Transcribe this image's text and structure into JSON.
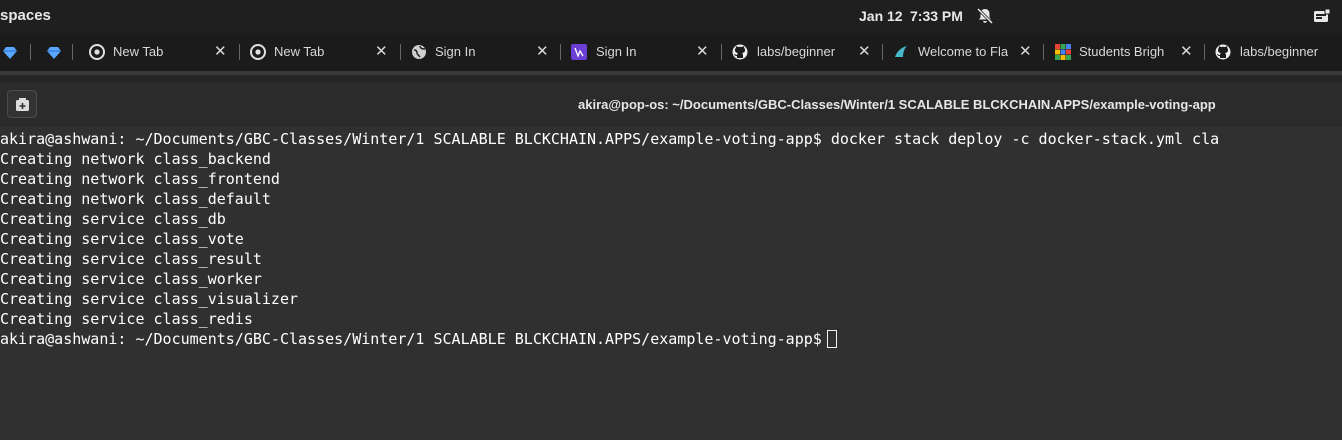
{
  "top_bar": {
    "workspace": "spaces",
    "date": "Jan 12",
    "time": "7:33 PM",
    "icons": [
      "notifications-off-icon",
      "system-menu-icon"
    ]
  },
  "browser_tabs": [
    {
      "label": "",
      "icon": "diamond-icon",
      "closable": false
    },
    {
      "label": "",
      "icon": "diamond-icon",
      "closable": false
    },
    {
      "label": "New Tab",
      "icon": "chrome-icon",
      "closable": true
    },
    {
      "label": "New Tab",
      "icon": "chrome-icon",
      "closable": true
    },
    {
      "label": "Sign In",
      "icon": "globe-icon",
      "closable": true
    },
    {
      "label": "Sign In",
      "icon": "purple-app-icon",
      "closable": true
    },
    {
      "label": "labs/beginner",
      "icon": "github-icon",
      "closable": true
    },
    {
      "label": "Welcome to Fla",
      "icon": "flask-icon",
      "closable": true
    },
    {
      "label": "Students Brigh",
      "icon": "grid-icon",
      "closable": true
    },
    {
      "label": "labs/beginner",
      "icon": "github-icon",
      "closable": true
    }
  ],
  "terminal": {
    "title": "akira@pop-os: ~/Documents/GBC-Classes/Winter/1 SCALABLE BLCKCHAIN.APPS/example-voting-app",
    "lines": [
      "akira@ashwani: ~/Documents/GBC-Classes/Winter/1 SCALABLE BLCKCHAIN.APPS/example-voting-app$ docker stack deploy -c docker-stack.yml cla",
      "Creating network class_backend",
      "Creating network class_frontend",
      "Creating network class_default",
      "Creating service class_db",
      "Creating service class_vote",
      "Creating service class_result",
      "Creating service class_worker",
      "Creating service class_visualizer",
      "Creating service class_redis"
    ],
    "prompt": "akira@ashwani: ~/Documents/GBC-Classes/Winter/1 SCALABLE BLCKCHAIN.APPS/example-voting-app$"
  }
}
